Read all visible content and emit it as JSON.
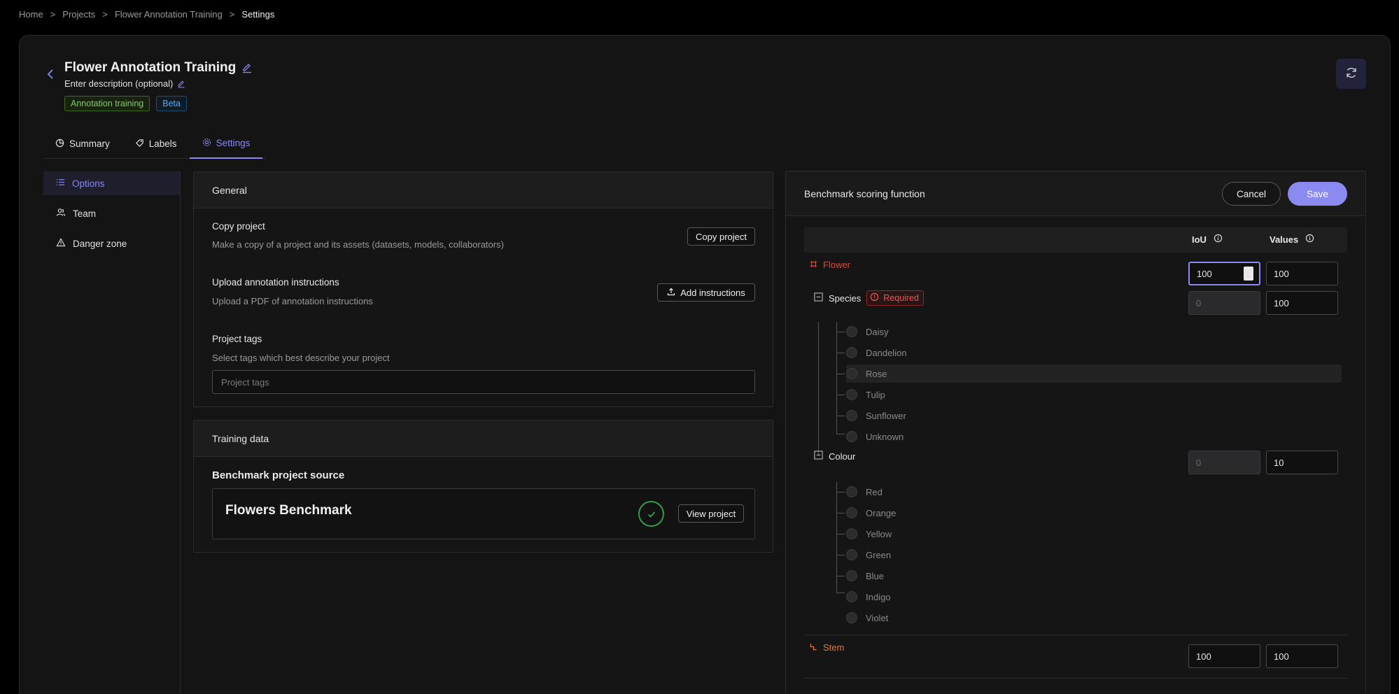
{
  "breadcrumb": [
    "Home",
    "Projects",
    "Flower Annotation Training",
    "Settings"
  ],
  "breadcrumb_sep": ">",
  "project": {
    "title": "Flower Annotation Training",
    "description": "Enter description (optional)",
    "tags": [
      "Annotation training",
      "Beta"
    ]
  },
  "tabs": [
    {
      "label": "Summary",
      "icon": "pie-chart-icon"
    },
    {
      "label": "Labels",
      "icon": "tag-icon"
    },
    {
      "label": "Settings",
      "icon": "gear-icon",
      "active": true
    }
  ],
  "sidenav": [
    {
      "label": "Options",
      "icon": "list-icon",
      "active": true
    },
    {
      "label": "Team",
      "icon": "team-icon"
    },
    {
      "label": "Danger zone",
      "icon": "warning-icon"
    }
  ],
  "general": {
    "heading": "General",
    "copy_title": "Copy project",
    "copy_sub": "Make a copy of a project and its assets (datasets, models, collaborators)",
    "copy_button": "Copy project",
    "upload_title": "Upload annotation instructions",
    "upload_sub": "Upload a PDF of annotation instructions",
    "upload_button": "Add instructions",
    "tags_title": "Project tags",
    "tags_sub": "Select tags which best describe your project",
    "tags_placeholder": "Project tags"
  },
  "training": {
    "heading": "Training data",
    "source_title": "Benchmark project source",
    "benchmark_name": "Flowers Benchmark",
    "view_button": "View project"
  },
  "scoring": {
    "heading": "Benchmark scoring function",
    "cancel": "Cancel",
    "save": "Save",
    "col_iou": "IoU",
    "col_values": "Values",
    "flower": {
      "label": "Flower",
      "iou": "100",
      "value": "100",
      "color": "#e0483c"
    },
    "species": {
      "label": "Species",
      "required": "Required",
      "iou": "0",
      "value": "100",
      "options": [
        "Daisy",
        "Dandelion",
        "Rose",
        "Tulip",
        "Sunflower",
        "Unknown"
      ]
    },
    "colour": {
      "label": "Colour",
      "iou": "0",
      "value": "10",
      "options": [
        "Red",
        "Orange",
        "Yellow",
        "Green",
        "Blue",
        "Indigo",
        "Violet"
      ]
    },
    "stem": {
      "label": "Stem",
      "iou": "100",
      "value": "100",
      "color": "#e8782c"
    }
  },
  "colors": {
    "accent": "#8b8af0",
    "success": "#2f9e4a",
    "danger": "#f05555"
  }
}
